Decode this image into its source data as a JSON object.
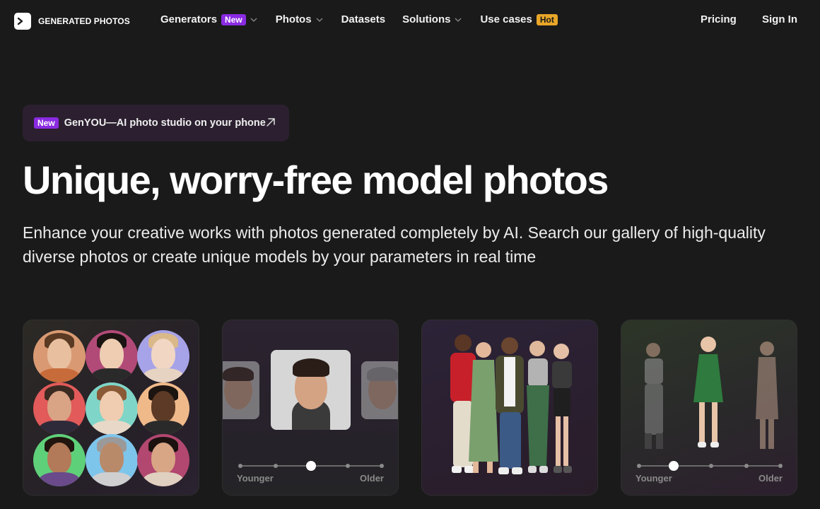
{
  "brand": {
    "name": "GENERATED PHOTOS"
  },
  "nav": {
    "items": [
      {
        "label": "Generators",
        "badge": "New",
        "has_dropdown": true
      },
      {
        "label": "Photos",
        "badge": null,
        "has_dropdown": true
      },
      {
        "label": "Datasets",
        "badge": null,
        "has_dropdown": false
      },
      {
        "label": "Solutions",
        "badge": null,
        "has_dropdown": true
      },
      {
        "label": "Use cases",
        "badge": "Hot",
        "has_dropdown": false
      }
    ],
    "pricing": "Pricing",
    "sign_in": "Sign In"
  },
  "promo": {
    "badge": "New",
    "text": "GenYOU—AI photo studio on your phone"
  },
  "hero": {
    "title": "Unique, worry-free model photos",
    "subtitle": "Enhance your creative works with photos generated completely by AI. Search our gallery of high-quality diverse photos or create unique models by your parameters in real time"
  },
  "cards": {
    "age_slider_1": {
      "left_label": "Younger",
      "right_label": "Older"
    },
    "age_slider_2": {
      "left_label": "Younger",
      "right_label": "Older"
    }
  },
  "colors": {
    "background": "#1a1a1a",
    "badge_new": "#8a2be2",
    "badge_hot": "#e8a628",
    "promo_bg": "#2c2030"
  }
}
